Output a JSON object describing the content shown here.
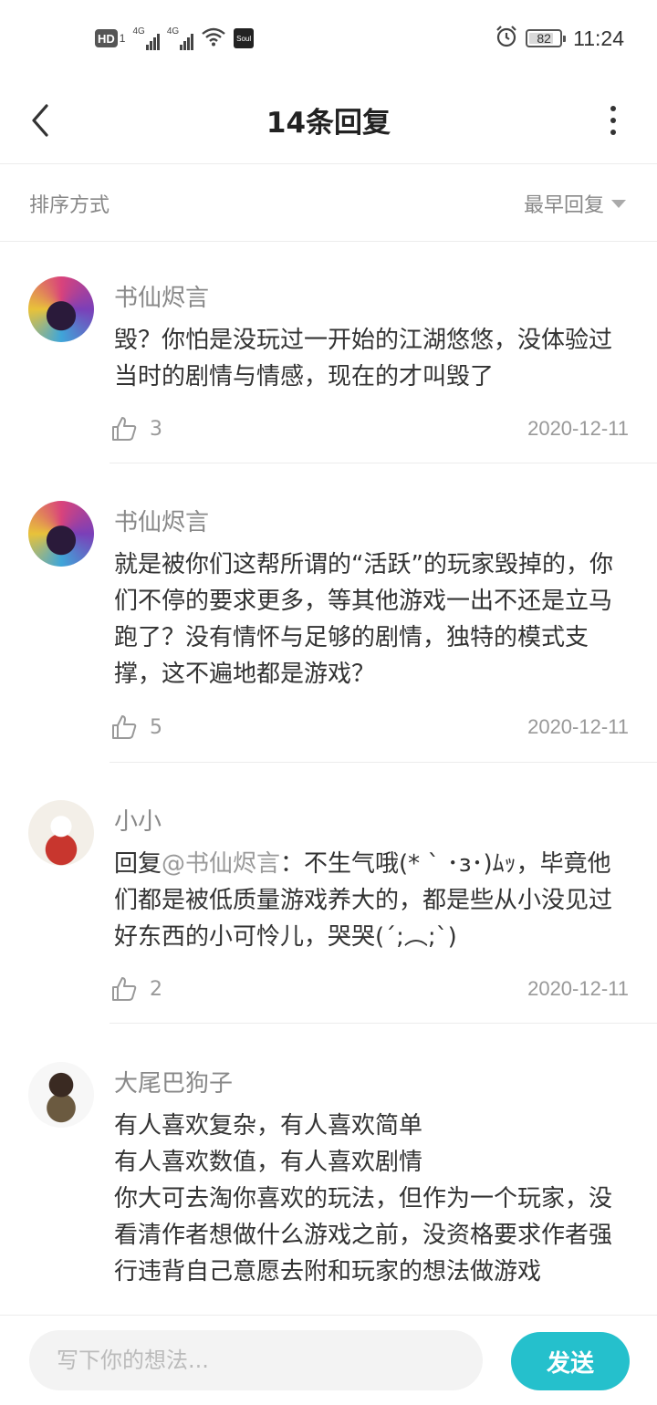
{
  "status_bar": {
    "hd_label": "HD",
    "sim_label": "1",
    "net1_label": "4G",
    "net2_label": "4G",
    "app_icon_label": "Soul",
    "battery_level": "82",
    "time": "11:24",
    "icons": [
      "signal-icon",
      "wifi-icon",
      "alarm-icon",
      "battery-icon"
    ]
  },
  "header": {
    "title": "14条回复"
  },
  "sort": {
    "label": "排序方式",
    "selected": "最早回复"
  },
  "comments": [
    {
      "author": "书仙烬言",
      "body": "毁？你怕是没玩过一开始的江湖悠悠，没体验过当时的剧情与情感，现在的才叫毁了",
      "likes": "3",
      "date": "2020-12-11"
    },
    {
      "author": "书仙烬言",
      "body": "就是被你们这帮所谓的“活跃”的玩家毁掉的，你们不停的要求更多，等其他游戏一出不还是立马跑了？没有情怀与足够的剧情，独特的模式支撑，这不遍地都是游戏？",
      "likes": "5",
      "date": "2020-12-11"
    },
    {
      "author": "小小",
      "reply_prefix": "回复",
      "mention": "@书仙烬言",
      "body": "：不生气哦(* ` ･з･)ﾑｯ，毕竟他们都是被低质量游戏养大的，都是些从小没见过好东西的小可怜儿，哭哭(´;︵;`)",
      "likes": "2",
      "date": "2020-12-11"
    },
    {
      "author": "大尾巴狗子",
      "body_lines": [
        "有人喜欢复杂，有人喜欢简单",
        "有人喜欢数值，有人喜欢剧情",
        "你大可去淘你喜欢的玩法，但作为一个玩家，没看清作者想做什么游戏之前，没资格要求作者强行违背自己意愿去附和玩家的想法做游戏"
      ]
    }
  ],
  "composer": {
    "placeholder": "写下你的想法...",
    "send_label": "发送"
  },
  "colors": {
    "accent": "#25c0cc",
    "muted_text": "#999999",
    "body_text": "#333333",
    "divider": "#ececec"
  }
}
